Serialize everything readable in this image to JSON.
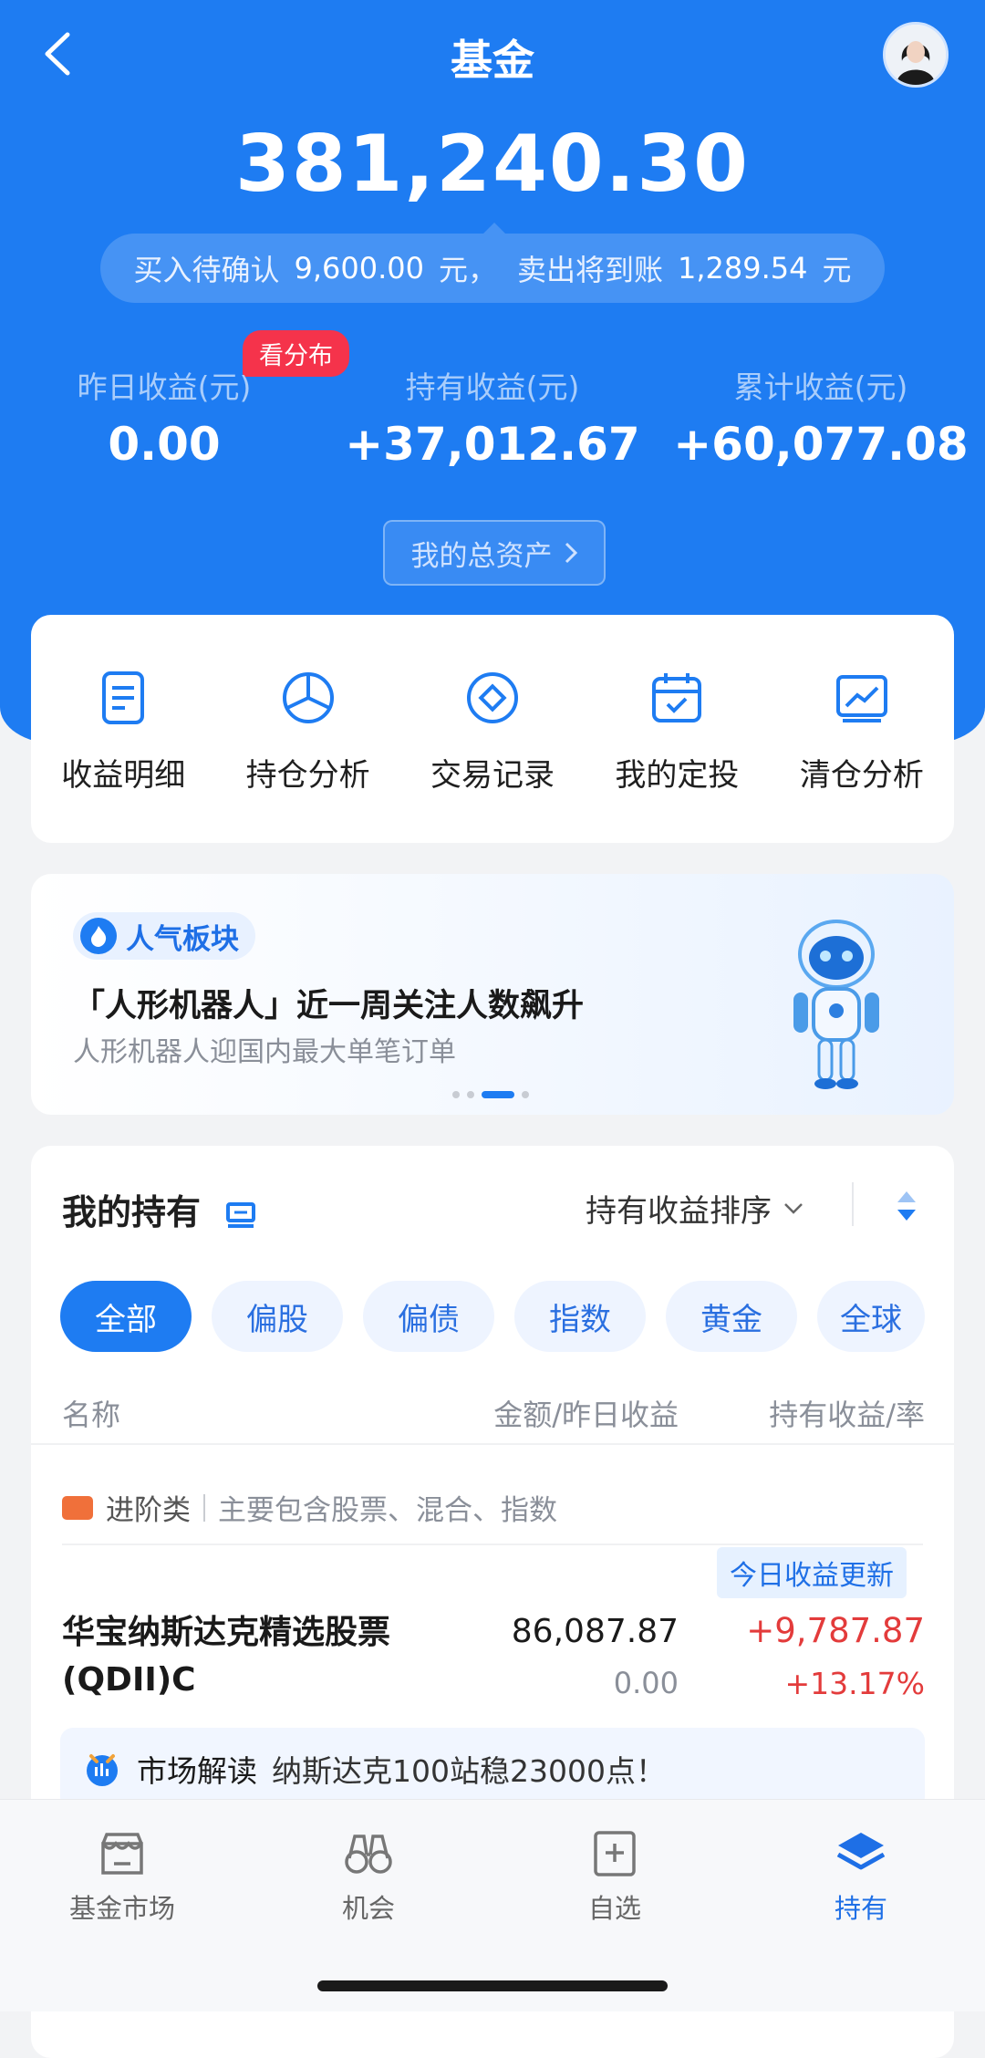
{
  "header": {
    "title": "基金"
  },
  "summary": {
    "total_amount": "381,240.30",
    "pending_buy_label": "买入待确认",
    "pending_buy_value": "9,600.00",
    "pending_buy_unit": "元，",
    "pending_sell_label": "卖出将到账",
    "pending_sell_value": "1,289.54",
    "pending_sell_unit": "元",
    "distribution_badge": "看分布",
    "stats": [
      {
        "label": "昨日收益(元)",
        "value": "0.00"
      },
      {
        "label": "持有收益(元)",
        "value": "+37,012.67"
      },
      {
        "label": "累计收益(元)",
        "value": "+60,077.08"
      }
    ],
    "assets_button": "我的总资产"
  },
  "quick_actions": [
    {
      "label": "收益明细",
      "icon": "document-icon"
    },
    {
      "label": "持仓分析",
      "icon": "pie-chart-icon"
    },
    {
      "label": "交易记录",
      "icon": "diamond-circle-icon"
    },
    {
      "label": "我的定投",
      "icon": "calendar-check-icon"
    },
    {
      "label": "清仓分析",
      "icon": "line-chart-icon"
    }
  ],
  "banner": {
    "tag": "人气板块",
    "title": "「人形机器人」近一周关注人数飙升",
    "subtitle": "人形机器人迎国内最大单笔订单",
    "page_count": 4,
    "active_page": 3
  },
  "holdings": {
    "title": "我的持有",
    "sort_label": "持有收益排序",
    "chips": [
      "全部",
      "偏股",
      "偏债",
      "指数",
      "黄金",
      "全球"
    ],
    "active_chip": 0,
    "columns": {
      "name": "名称",
      "amount": "金额/昨日收益",
      "profit": "持有收益/率"
    },
    "category": {
      "name": "进阶类",
      "desc": "主要包含股票、混合、指数"
    },
    "today_tag": "今日收益更新",
    "funds": [
      {
        "name": "华宝纳斯达克精选股票(QDII)C",
        "amount": "86,087.87",
        "yesterday": "0.00",
        "profit": "+9,787.87",
        "rate": "+13.17%"
      }
    ],
    "market": {
      "label": "市场解读",
      "text": "纳斯达克100站稳23000点！"
    }
  },
  "tabbar": [
    {
      "label": "基金市场",
      "icon": "store-icon"
    },
    {
      "label": "机会",
      "icon": "binoculars-icon"
    },
    {
      "label": "自选",
      "icon": "add-square-icon"
    },
    {
      "label": "持有",
      "icon": "layers-icon"
    }
  ],
  "colors": {
    "primary": "#1e7cf2",
    "profit_red": "#e33b3b",
    "badge_red": "#f5334b"
  }
}
